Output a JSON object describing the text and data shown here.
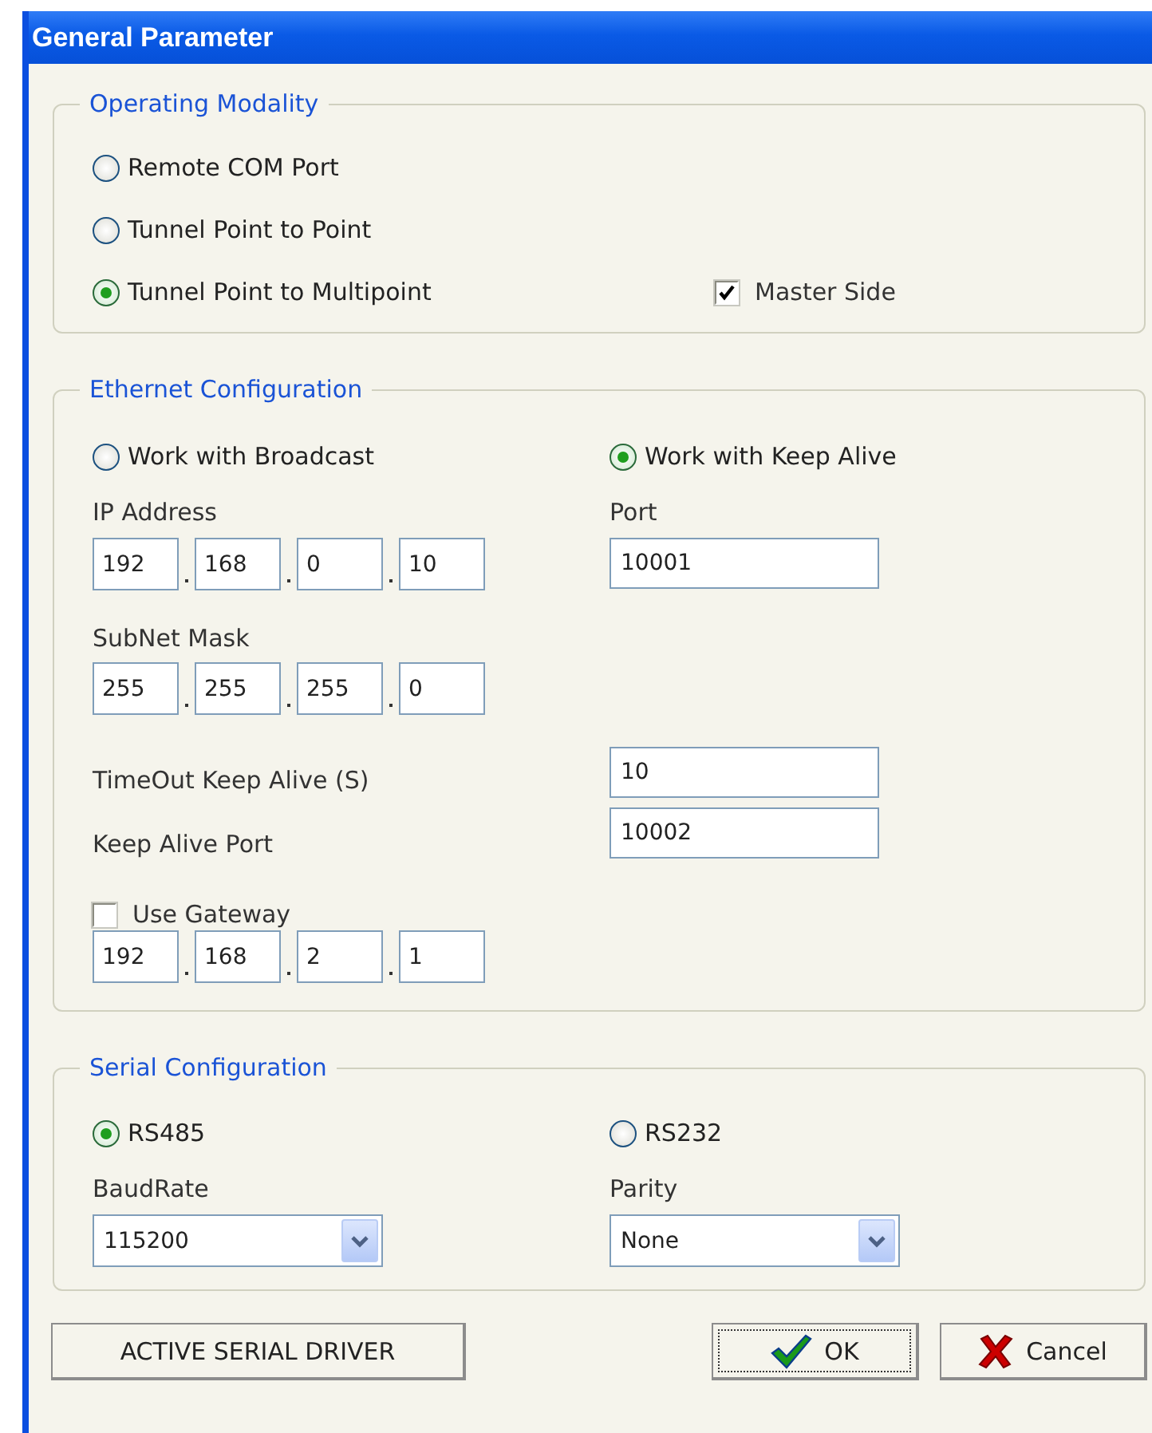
{
  "window": {
    "title": "General Parameter"
  },
  "operating_modality": {
    "legend": "Operating Modality",
    "options": [
      {
        "label": "Remote COM Port",
        "selected": false
      },
      {
        "label": "Tunnel Point to Point",
        "selected": false
      },
      {
        "label": "Tunnel Point to Multipoint",
        "selected": true
      }
    ],
    "master_side": {
      "label": "Master Side",
      "checked": true
    }
  },
  "ethernet_configuration": {
    "legend": "Ethernet Configuration",
    "modes": [
      {
        "label": "Work with Broadcast",
        "selected": false
      },
      {
        "label": "Work with Keep Alive",
        "selected": true
      }
    ],
    "ip_address": {
      "label": "IP Address",
      "octets": [
        "192",
        "168",
        "0",
        "10"
      ]
    },
    "port": {
      "label": "Port",
      "value": "10001"
    },
    "subnet_mask": {
      "label": "SubNet Mask",
      "octets": [
        "255",
        "255",
        "255",
        "0"
      ]
    },
    "timeout_keep_alive": {
      "label": "TimeOut Keep Alive (S)",
      "value": "10"
    },
    "keep_alive_port": {
      "label": "Keep Alive Port",
      "value": "10002"
    },
    "use_gateway": {
      "label": "Use Gateway",
      "checked": false,
      "octets": [
        "192",
        "168",
        "2",
        "1"
      ]
    }
  },
  "serial_configuration": {
    "legend": "Serial Configuration",
    "interfaces": [
      {
        "label": "RS485",
        "selected": true
      },
      {
        "label": "RS232",
        "selected": false
      }
    ],
    "baud_rate": {
      "label": "BaudRate",
      "value": "115200"
    },
    "parity": {
      "label": "Parity",
      "value": "None"
    }
  },
  "buttons": [
    {
      "label": "ACTIVE SERIAL DRIVER",
      "kind": "plain",
      "focused": false
    },
    {
      "label": "OK",
      "kind": "ok",
      "focused": true
    },
    {
      "label": "Cancel",
      "kind": "cancel",
      "focused": false
    }
  ]
}
